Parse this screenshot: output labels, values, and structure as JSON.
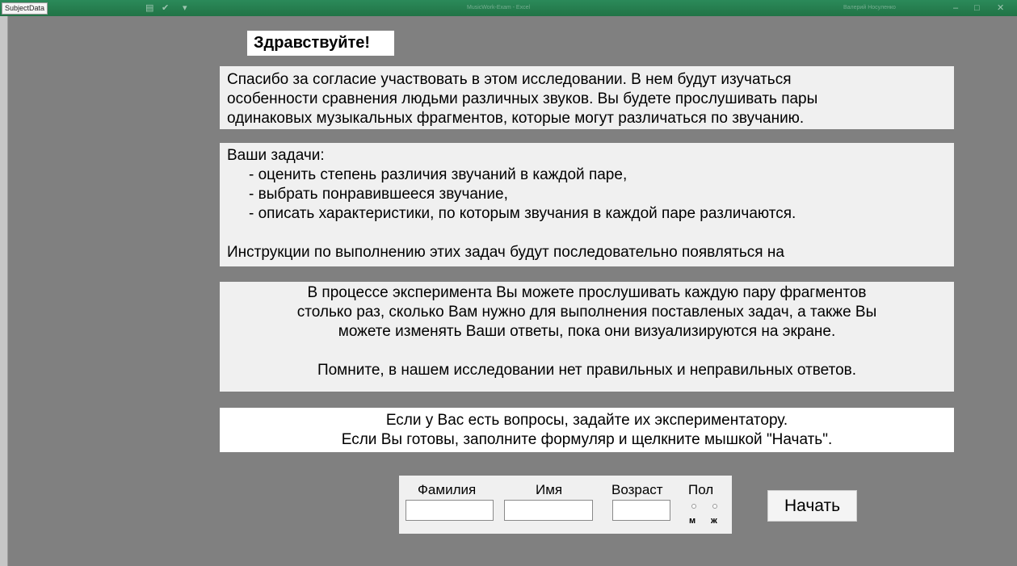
{
  "window": {
    "sheet_tab": "SubjectData",
    "title": "MusicWork-Exam - Excel",
    "user": "Валерий Носуленко"
  },
  "greeting": "Здравствуйте!",
  "intro": {
    "lines": [
      "Спасибо за согласие участвовать в этом исследовании. В нем будут изучаться",
      "особенности сравнения людьми различных звуков. Вы будете прослушивать пары",
      "одинаковых музыкальных фрагментов, которые могут различаться по звучанию."
    ]
  },
  "tasks": {
    "heading": "Ваши задачи:",
    "items": [
      "- оценить степень различия звучаний в каждой паре,",
      "- выбрать понравившееся звучание,",
      "- описать характеристики, по которым звучания в каждой паре различаются."
    ],
    "footer": "Инструкции по выполнению этих задач будут последовательно появляться на"
  },
  "process": {
    "lines": [
      "В процессе эксперимента Вы можете прослушивать каждую пару фрагментов",
      "столько раз, сколько Вам нужно для выполнения поставленых задач, а также Вы",
      "можете изменять Ваши ответы, пока они визуализируются на экране."
    ],
    "note": "Помните, в нашем исследовании нет правильных и неправильных ответов."
  },
  "questions": {
    "lines": [
      "Если у Вас есть вопросы, задайте их экспериментатору.",
      "Если Вы готовы, заполните формуляр и щелкните мышкой \"Начать\"."
    ]
  },
  "form": {
    "surname_label": "Фамилия",
    "name_label": "Имя",
    "age_label": "Возраст",
    "sex_label": "Пол",
    "sex_male": "м",
    "sex_female": "ж",
    "surname_value": "",
    "name_value": "",
    "age_value": ""
  },
  "start_button": "Начать"
}
